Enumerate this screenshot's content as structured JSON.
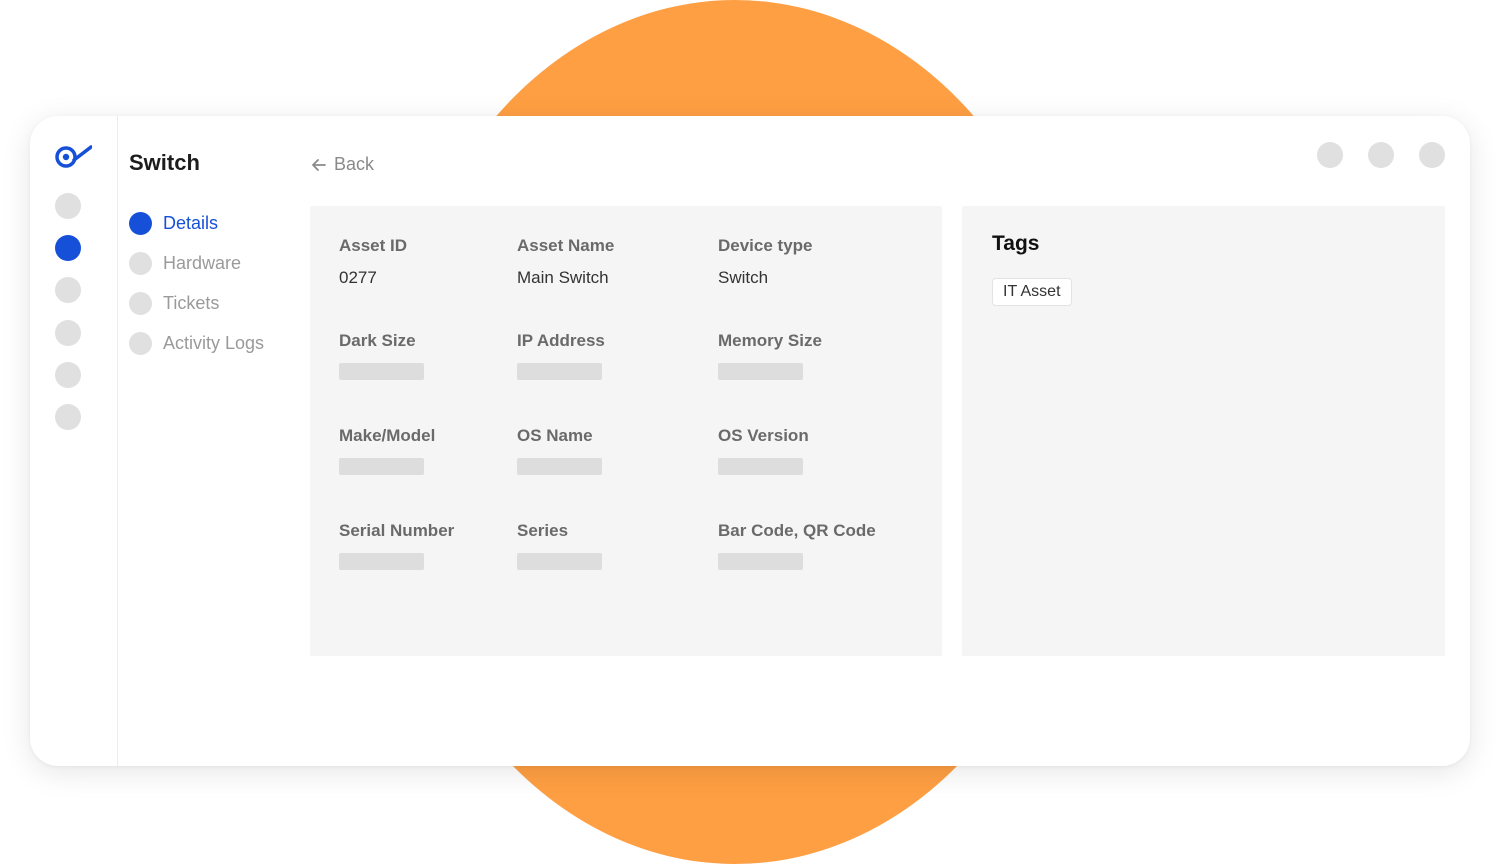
{
  "colors": {
    "accent": "#1650d8",
    "background_circle": "#FF9F43",
    "placeholder": "#e0e0e0"
  },
  "logo": {
    "icon": "eye-check-logo"
  },
  "rail": {
    "items": [
      {
        "icon": "nav-dot",
        "active": false
      },
      {
        "icon": "nav-dot",
        "active": true
      },
      {
        "icon": "nav-dot",
        "active": false
      },
      {
        "icon": "nav-dot",
        "active": false
      },
      {
        "icon": "nav-dot",
        "active": false
      },
      {
        "icon": "nav-dot",
        "active": false
      }
    ]
  },
  "page": {
    "title": "Switch",
    "back_label": "Back"
  },
  "subnav": {
    "items": [
      {
        "label": "Details",
        "active": true
      },
      {
        "label": "Hardware",
        "active": false
      },
      {
        "label": "Tickets",
        "active": false
      },
      {
        "label": "Activity Logs",
        "active": false
      }
    ]
  },
  "top_actions": [
    {
      "icon": "placeholder-dot"
    },
    {
      "icon": "placeholder-dot"
    },
    {
      "icon": "placeholder-dot"
    }
  ],
  "details": {
    "fields": [
      {
        "label": "Asset ID",
        "value": "0277"
      },
      {
        "label": "Asset Name",
        "value": "Main Switch"
      },
      {
        "label": "Device type",
        "value": "Switch"
      },
      {
        "label": "Dark Size",
        "value": null
      },
      {
        "label": "IP Address",
        "value": null
      },
      {
        "label": "Memory Size",
        "value": null
      },
      {
        "label": "Make/Model",
        "value": null
      },
      {
        "label": "OS Name",
        "value": null
      },
      {
        "label": "OS Version",
        "value": null
      },
      {
        "label": "Serial Number",
        "value": null
      },
      {
        "label": "Series",
        "value": null
      },
      {
        "label": "Bar Code, QR Code",
        "value": null
      }
    ]
  },
  "tags": {
    "title": "Tags",
    "items": [
      "IT Asset"
    ]
  }
}
